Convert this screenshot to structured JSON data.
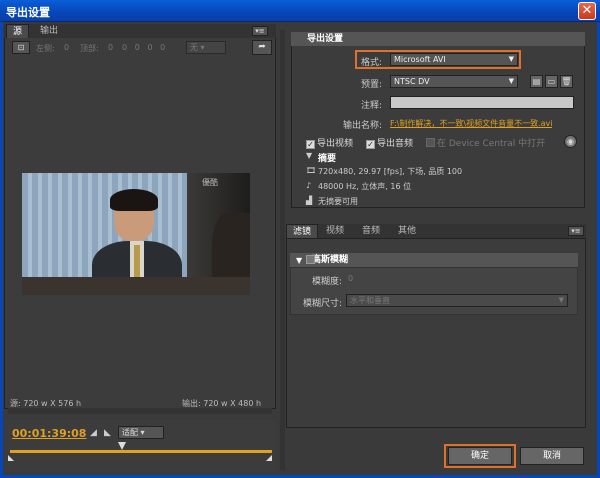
{
  "window": {
    "title": "导出设置",
    "close_glyph": "✕"
  },
  "left_tabs": [
    {
      "label": "源"
    },
    {
      "label": "输出"
    }
  ],
  "menu_glyph": "▾≡",
  "crop": {
    "left_label": "左侧:",
    "left_value": "0",
    "top_label": "顶部:",
    "top_value": "0",
    "ratio_select": "无"
  },
  "watermark": "優酷",
  "source_info": "源: 720 w X 576 h",
  "output_info": "输出: 720 w X 480 h",
  "timeline": {
    "timecode": "00:01:39:08",
    "fit_select": "适配"
  },
  "export_settings": {
    "section_title": "导出设置",
    "format_label": "格式:",
    "format_value": "Microsoft AVI",
    "preset_label": "预置:",
    "preset_value": "NTSC DV",
    "comment_label": "注释:",
    "comment_value": "",
    "output_name_label": "输出名称:",
    "output_name_value": "F:\\制作解决，不一致\\视频文件音量不一致.avi",
    "export_video_label": "导出视频",
    "export_audio_label": "导出音频",
    "device_central_label": "在 Device Central 中打开",
    "summary_title": "摘要",
    "summary_video": "720x480, 29.97 [fps], 下场, 品质 100",
    "summary_audio": "48000 Hz, 立体声, 16 位",
    "summary_none": "无摘要可用"
  },
  "right_tabs": [
    {
      "label": "滤镜"
    },
    {
      "label": "视频"
    },
    {
      "label": "音频"
    },
    {
      "label": "其他"
    }
  ],
  "filter": {
    "title": "高斯模糊",
    "blur_label": "模糊度:",
    "blur_value": "0",
    "dimension_label": "模糊尺寸:",
    "dimension_value": "水平和垂直"
  },
  "buttons": {
    "ok": "确定",
    "cancel": "取消"
  },
  "colors": {
    "accent": "#e0a020",
    "highlight": "#e0702a",
    "titlebar": "#0646b8"
  }
}
